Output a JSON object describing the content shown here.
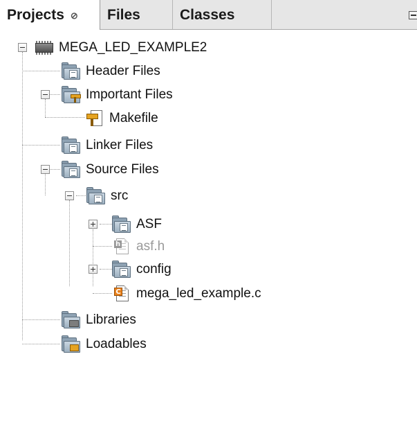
{
  "tabs": [
    {
      "label": "Projects",
      "close": "⊘",
      "active": true
    },
    {
      "label": "Files",
      "active": false
    },
    {
      "label": "Classes",
      "active": false
    }
  ],
  "tree": {
    "project": "MEGA_LED_EXAMPLE2",
    "header_files": "Header Files",
    "important_files": "Important Files",
    "makefile": "Makefile",
    "linker_files": "Linker Files",
    "source_files": "Source Files",
    "src": "src",
    "asf": "ASF",
    "asf_h": "asf.h",
    "config": "config",
    "main_c": "mega_led_example.c",
    "libraries": "Libraries",
    "loadables": "Loadables"
  },
  "icons": {
    "project": "chip-icon",
    "folder": "folder-icon",
    "makefile": "makefile-icon",
    "header": "header-file-icon",
    "c_source": "c-file-icon"
  },
  "colors": {
    "tab_bar": "#e6e6e6",
    "folder": "#8fa3b4",
    "c_badge": "#e8811d",
    "disabled_text": "#9a9a9a"
  }
}
